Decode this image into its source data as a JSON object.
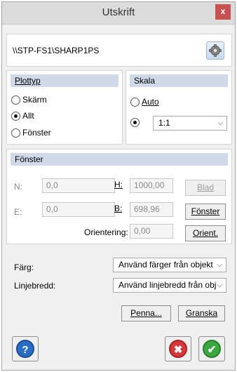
{
  "window": {
    "title": "Utskrift",
    "close_label": "x"
  },
  "printer": {
    "name": "\\\\STP-FS1\\SHARP1PS",
    "settings_icon": "gear-icon"
  },
  "plottyp": {
    "header": "Plottyp",
    "options": [
      {
        "label": "Skärm",
        "checked": false
      },
      {
        "label": "Allt",
        "checked": true
      },
      {
        "label": "Fönster",
        "checked": false
      }
    ]
  },
  "skala": {
    "header": "Skala",
    "auto_label": "Auto",
    "auto_checked": false,
    "custom_checked": true,
    "scale_value": "1:1"
  },
  "fonster": {
    "header": "Fönster",
    "n_label": "N:",
    "n_value": "0,0",
    "e_label": "E:",
    "e_value": "0,0",
    "h_label": "H:",
    "h_value": "1000,00",
    "b_label": "B:",
    "b_value": "698,96",
    "orientering_label": "Orientering:",
    "orientering_value": "0,00",
    "blad_button": "Blad",
    "fonster_button": "Fönster",
    "orient_button": "Orient."
  },
  "farg": {
    "label": "Färg:",
    "value": "Använd färger från objekt"
  },
  "linjebredd": {
    "label": "Linjebredd:",
    "value": "Använd linjebredd från obj"
  },
  "buttons": {
    "penna": "Penna...",
    "granska": "Granska"
  },
  "footer": {
    "help_icon": "help-icon",
    "cancel_icon": "cancel-icon",
    "ok_icon": "ok-icon"
  },
  "colors": {
    "title_close": "#c75050",
    "group_header": "#cfd9e8",
    "help_blue": "#2b6cc4",
    "cancel_red": "#d7383a",
    "ok_green": "#3aa83e"
  }
}
